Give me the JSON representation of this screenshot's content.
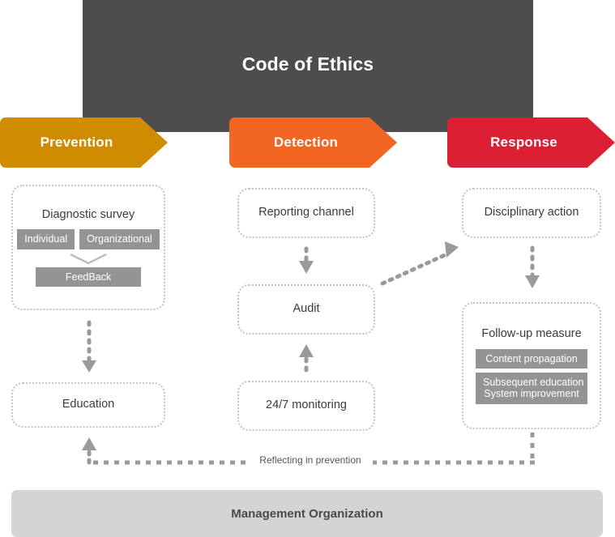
{
  "header": {
    "title": "Code of Ethics",
    "bg_color": "#4d4d4d"
  },
  "banners": [
    {
      "id": "prevention",
      "label": "Prevention",
      "color": "#d08c00"
    },
    {
      "id": "detection",
      "label": "Detection",
      "color": "#f26522"
    },
    {
      "id": "response",
      "label": "Response",
      "color": "#da2032"
    }
  ],
  "columns": {
    "prevention": {
      "diagnostic_survey": {
        "title": "Diagnostic survey",
        "chips": [
          "Individual",
          "Organizational"
        ],
        "feedback_chip": "FeedBack"
      },
      "education": {
        "title": "Education"
      }
    },
    "detection": {
      "reporting_channel": {
        "title": "Reporting channel"
      },
      "audit": {
        "title": "Audit"
      },
      "monitoring": {
        "title": "24/7 monitoring"
      }
    },
    "response": {
      "disciplinary_action": {
        "title": "Disciplinary action"
      },
      "follow_up": {
        "title": "Follow-up measure",
        "chips": [
          "Content propagation",
          "Subsequent education\nSystem improvement"
        ],
        "chip_content_propagation": "Content propagation",
        "chip_subsequent_line1": "Subsequent education",
        "chip_subsequent_line2": "System improvement"
      }
    }
  },
  "connectors": {
    "reflect_label": "Reflecting in prevention",
    "dot_color": "#9a9a9a"
  },
  "footer": {
    "label": "Management Organization",
    "bg_color": "#d4d4d4"
  }
}
